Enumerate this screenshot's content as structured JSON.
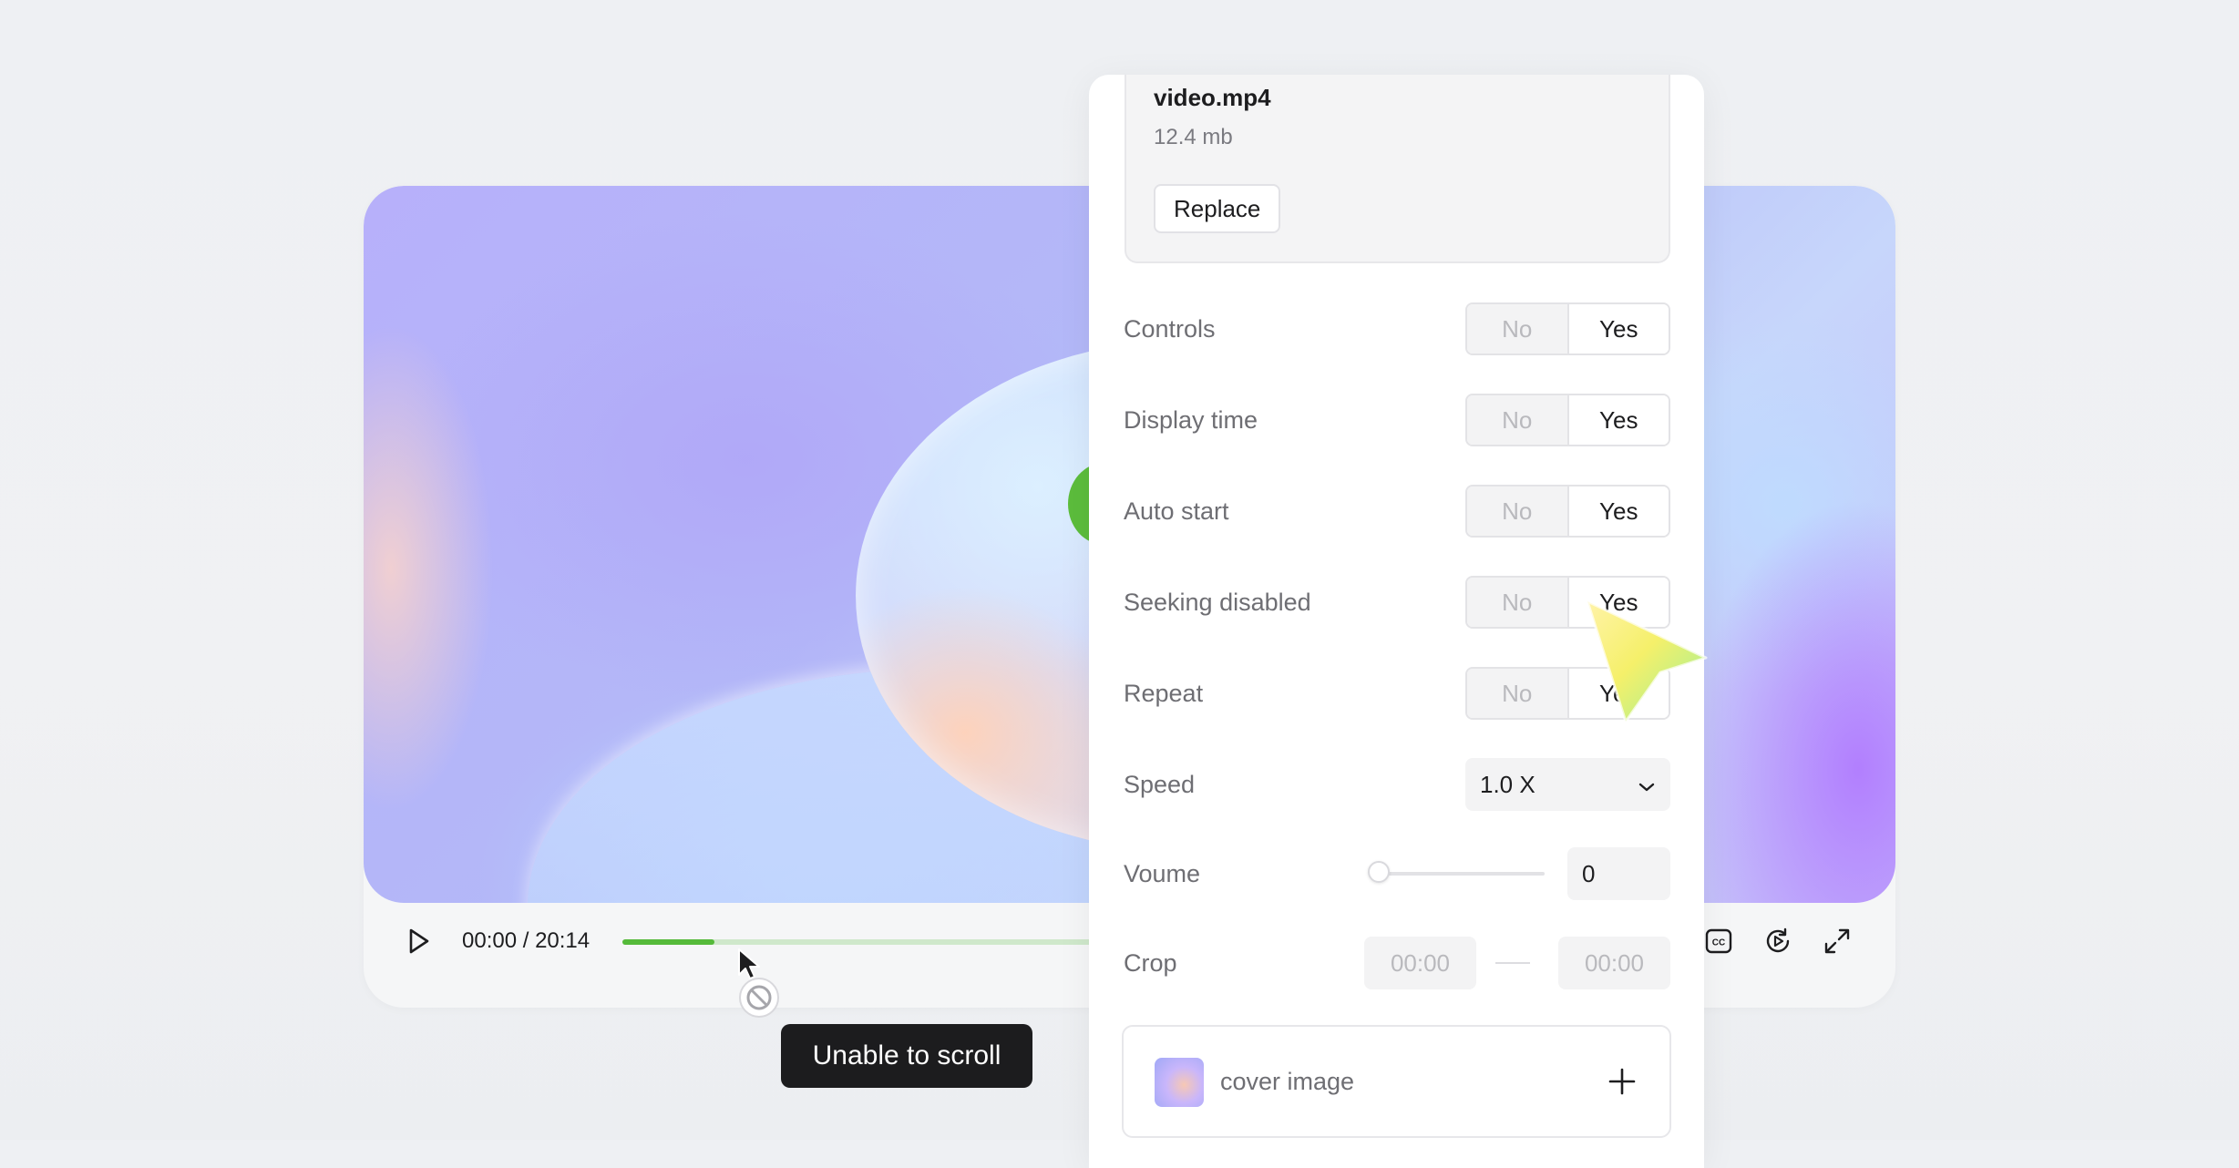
{
  "player": {
    "time_display": "00:00 / 20:14",
    "progress_fraction": 0.18,
    "icons": [
      "play-icon",
      "captions-icon",
      "replay-icon",
      "fullscreen-icon"
    ]
  },
  "file": {
    "name": "video.mp4",
    "size": "12.4 mb",
    "replace_label": "Replace"
  },
  "settings": {
    "toggles": [
      {
        "label": "Controls",
        "no": "No",
        "yes": "Yes",
        "selected": "Yes"
      },
      {
        "label": "Display time",
        "no": "No",
        "yes": "Yes",
        "selected": "Yes"
      },
      {
        "label": "Auto start",
        "no": "No",
        "yes": "Yes",
        "selected": "Yes"
      },
      {
        "label": "Seeking disabled",
        "no": "No",
        "yes": "Yes",
        "selected": "Yes"
      },
      {
        "label": "Repeat",
        "no": "No",
        "yes": "Yes",
        "selected": "Yes"
      }
    ],
    "speed": {
      "label": "Speed",
      "value": "1.0 X"
    },
    "volume": {
      "label": "Voume",
      "value": "0",
      "level_fraction": 0
    },
    "crop": {
      "label": "Crop",
      "start": "00:00",
      "end": "00:00"
    },
    "cover": {
      "label": "cover image"
    }
  },
  "tooltip": {
    "text": "Unable to scroll"
  },
  "colors": {
    "progress_fill": "#55ba3a",
    "progress_track": "#cfe8cb",
    "tooltip_bg": "#1c1c1e",
    "panel_bg": "#ffffff"
  }
}
